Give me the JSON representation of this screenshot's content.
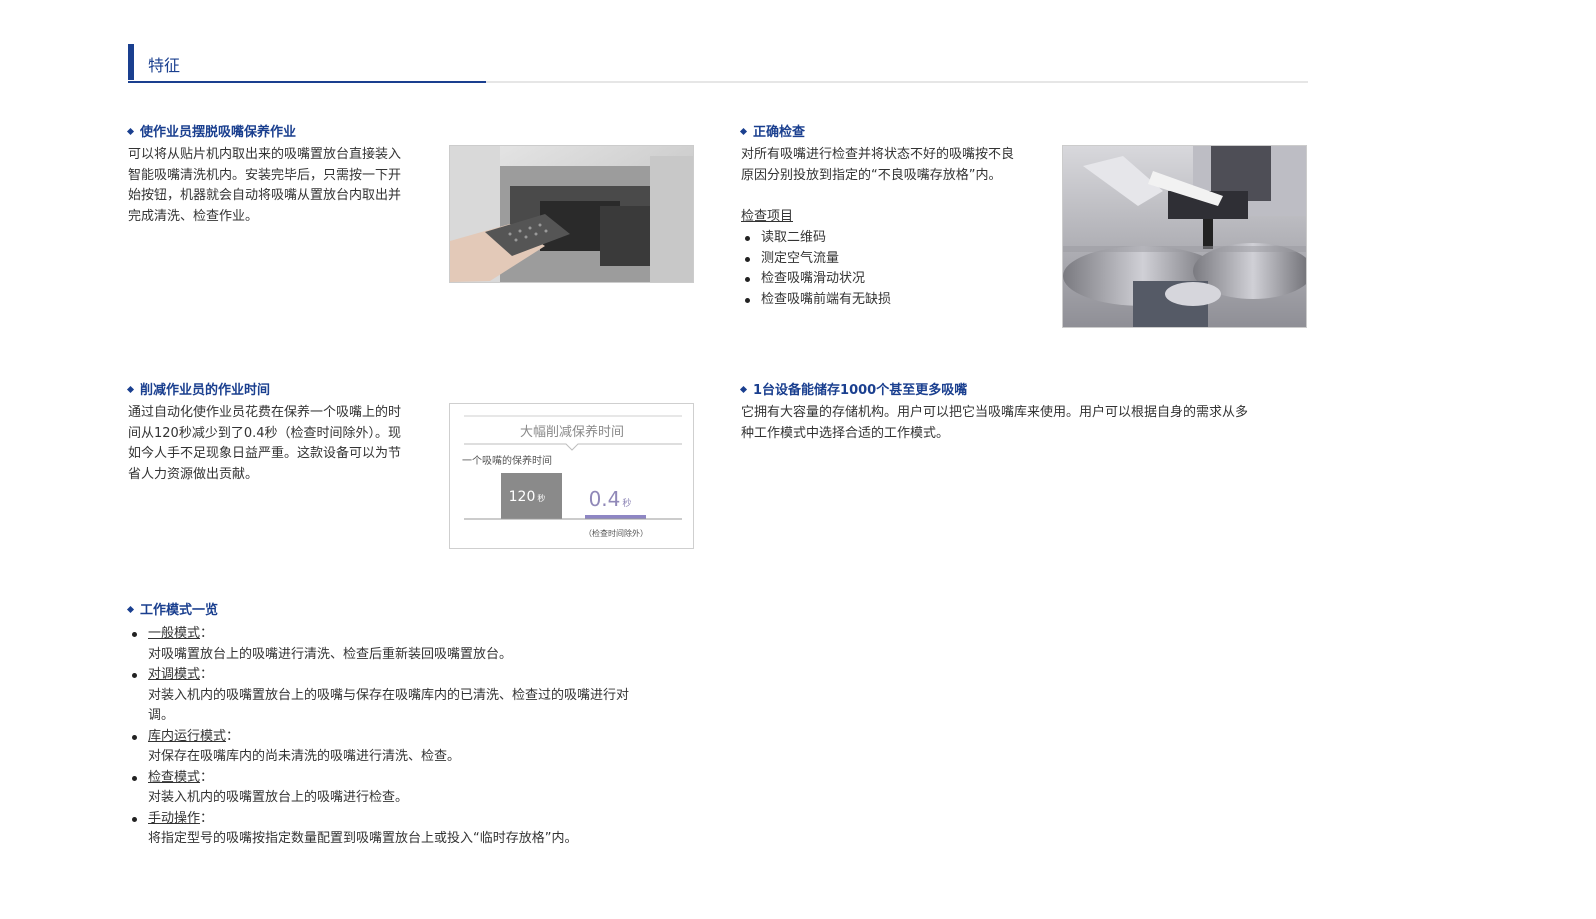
{
  "section": {
    "title": "特征"
  },
  "features": {
    "f1": {
      "title": "使作业员摆脱吸嘴保养作业",
      "lines": [
        "可以将从贴片机内取出来的吸嘴置放台直接装入",
        "智能吸嘴清洗机内。安装完毕后，只需按一下开",
        "始按钮，机器就会自动将吸嘴从置放台内取出并",
        "完成清洗、检查作业。"
      ]
    },
    "f2": {
      "title": "正确检查",
      "lines": [
        "对所有吸嘴进行检查并将状态不好的吸嘴按不良",
        "原因分别投放到指定的“不良吸嘴存放格”内。"
      ],
      "list_title": "检查项目",
      "items": [
        "读取二维码",
        "测定空气流量",
        "检查吸嘴滑动状况",
        "检查吸嘴前端有无缺损"
      ]
    },
    "f3": {
      "title": "削减作业员的作业时间",
      "lines": [
        "通过自动化使作业员花费在保养一个吸嘴上的时",
        "间从120秒减少到了0.4秒（检查时间除外）。现",
        "如今人手不足现象日益严重。这款设备可以为节",
        "省人力资源做出贡献。"
      ]
    },
    "f4": {
      "title": "1台设备能储存1000个甚至更多吸嘴",
      "lines": [
        "它拥有大容量的存储机构。用户可以把它当吸嘴库来使用。用户可以根据自身的需求从多",
        "种工作模式中选择合适的工作模式。"
      ]
    },
    "f5": {
      "title": "工作模式一览",
      "modes": [
        {
          "name": "一般模式",
          "lines": [
            "对吸嘴置放台上的吸嘴进行清洗、检查后重新装回吸嘴置放台。"
          ]
        },
        {
          "name": "对调模式",
          "lines": [
            "对装入机内的吸嘴置放台上的吸嘴与保存在吸嘴库内的已清洗、检查过的吸嘴进行对",
            "调。"
          ]
        },
        {
          "name": "库内运行模式",
          "lines": [
            "对保存在吸嘴库内的尚未清洗的吸嘴进行清洗、检查。"
          ]
        },
        {
          "name": "检查模式",
          "lines": [
            "对装入机内的吸嘴置放台上的吸嘴进行检查。"
          ]
        },
        {
          "name": "手动操作",
          "lines": [
            "将指定型号的吸嘴按指定数量配置到吸嘴置放台上或投入“临时存放格”内。"
          ]
        }
      ],
      "colon": "："
    }
  },
  "chart_data": {
    "type": "bar",
    "title": "大幅削减保养时间",
    "ylabel": "一个吸嘴的保养时间",
    "series": [
      {
        "values": [
          120,
          0.4
        ]
      }
    ],
    "value_labels": [
      "120",
      "0.4"
    ],
    "unit": "秒",
    "annotation": "（检查时间除外）",
    "colors": {
      "bar1": "#8a8a8a",
      "bar2": "#8e86c4",
      "label2": "#9088b8"
    }
  }
}
